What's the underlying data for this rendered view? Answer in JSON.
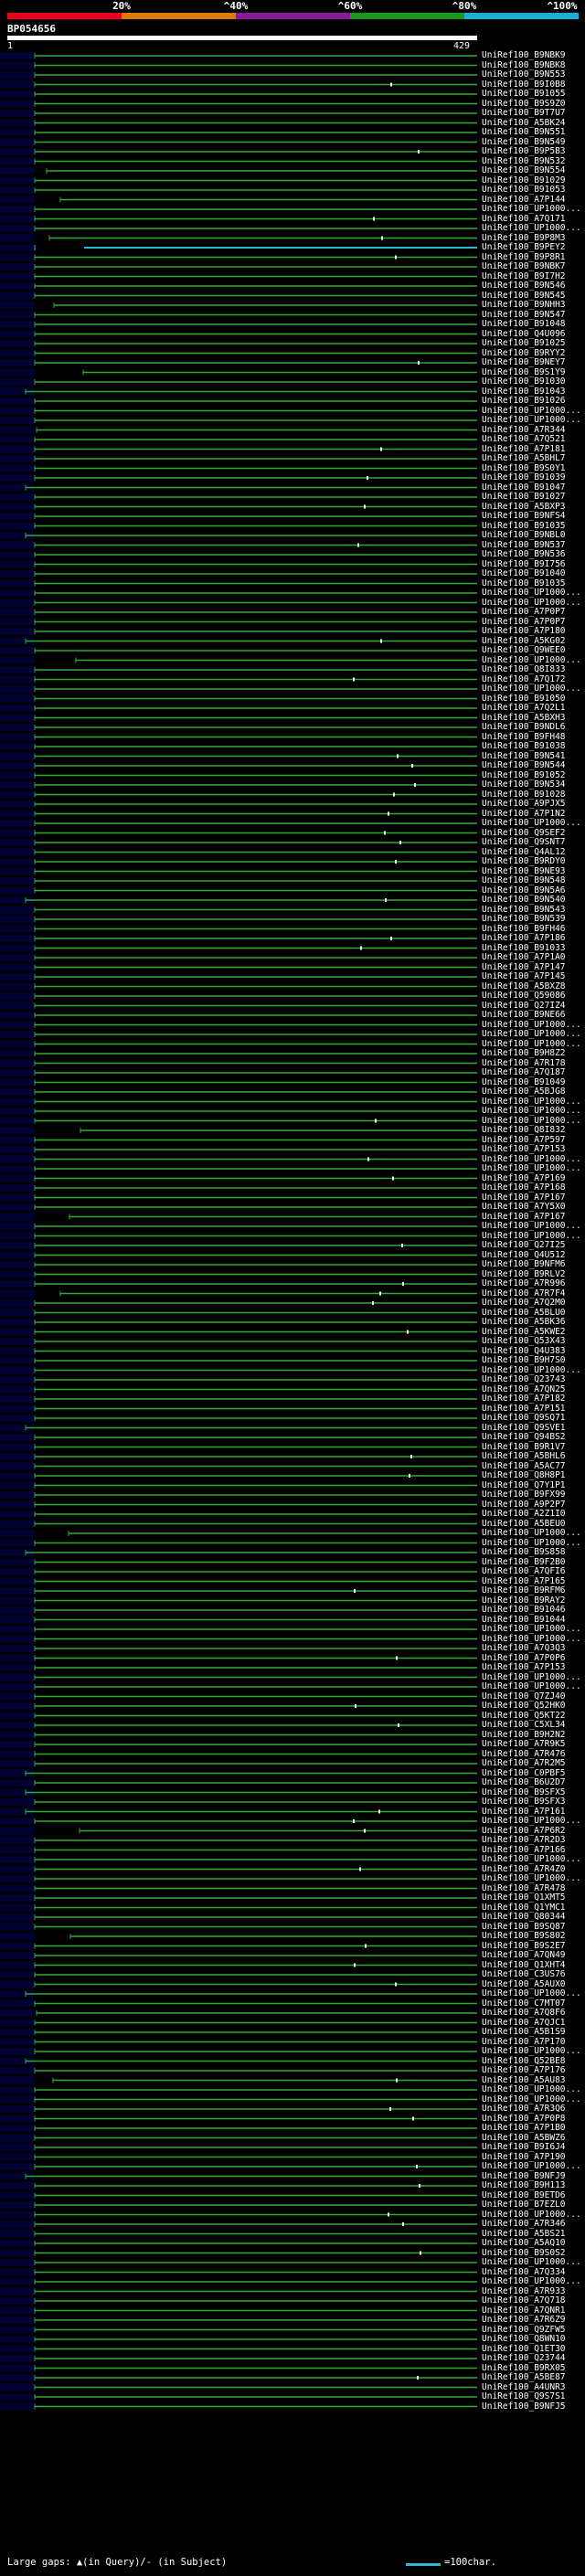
{
  "legend": {
    "marks": [
      "20%",
      "^40%",
      "^60%",
      "^80%",
      "^100%"
    ],
    "colors": [
      "#e8001c",
      "#e07a00",
      "#8a1a9a",
      "#1a9a1a",
      "#1ab0d6"
    ]
  },
  "query": {
    "name": "BP054656",
    "start": "1",
    "end": "429"
  },
  "hits": [
    "UniRef100_B9NBK9",
    "UniRef100_B9NBK8",
    "UniRef100_B9N553",
    "UniRef100_B9I0B8",
    "UniRef100_B91055",
    "UniRef100_B9S9Z0",
    "UniRef100_B9T7U7",
    "UniRef100_A5BK24",
    "UniRef100_B9N551",
    "UniRef100_B9N549",
    "UniRef100_B9P5B3",
    "UniRef100_B9N532",
    "UniRef100_B9N554",
    "UniRef100_B91029",
    "UniRef100_B91053",
    "UniRef100_A7P144",
    "UniRef100_UP1000...",
    "UniRef100_A7Q171",
    "UniRef100_UP1000...",
    "UniRef100_B9P8M3",
    "UniRef100_B9PEY2",
    "UniRef100_B9P8R1",
    "UniRef100_B9NBK7",
    "UniRef100_B9I7H2",
    "UniRef100_B9N546",
    "UniRef100_B9N545",
    "UniRef100_B9NHH3",
    "UniRef100_B9N547",
    "UniRef100_B91048",
    "UniRef100_Q4U096",
    "UniRef100_B91025",
    "UniRef100_B9RYY2",
    "UniRef100_B9NEY7",
    "UniRef100_B9S1Y9",
    "UniRef100_B91030",
    "UniRef100_B91043",
    "UniRef100_B91026",
    "UniRef100_UP1000...",
    "UniRef100_UP1000...",
    "UniRef100_A7R344",
    "UniRef100_A7Q521",
    "UniRef100_A7P181",
    "UniRef100_A5BHL7",
    "UniRef100_B9S0Y1",
    "UniRef100_B91039",
    "UniRef100_B91047",
    "UniRef100_B91027",
    "UniRef100_A5BXP3",
    "UniRef100_B9NFS4",
    "UniRef100_B91035",
    "UniRef100_B9NBL0",
    "UniRef100_B9N537",
    "UniRef100_B9N536",
    "UniRef100_B9I756",
    "UniRef100_B91040",
    "UniRef100_B91035",
    "UniRef100_UP1000...",
    "UniRef100_UP1000...",
    "UniRef100_A7P0P7",
    "UniRef100_A7P0P7",
    "UniRef100_A7P180",
    "UniRef100_A5KG02",
    "UniRef100_Q9WEE0",
    "UniRef100_UP1000...",
    "UniRef100_Q8I833",
    "UniRef100_A7Q172",
    "UniRef100_UP1000...",
    "UniRef100_B91050",
    "UniRef100_A7Q2L1",
    "UniRef100_A5BXH3",
    "UniRef100_B9NDL6",
    "UniRef100_B9FH48",
    "UniRef100_B91038",
    "UniRef100_B9N541",
    "UniRef100_B9N544",
    "UniRef100_B91052",
    "UniRef100_B9N534",
    "UniRef100_B91028",
    "UniRef100_A9PJX5",
    "UniRef100_A7P1N2",
    "UniRef100_UP1000...",
    "UniRef100_Q9SEF2",
    "UniRef100_Q9SNT7",
    "UniRef100_Q4AL12",
    "UniRef100_B9RDY0",
    "UniRef100_B9NE93",
    "UniRef100_B9N548",
    "UniRef100_B9N5A6",
    "UniRef100_B9N540",
    "UniRef100_B9N543",
    "UniRef100_B9N539",
    "UniRef100_B9FH46",
    "UniRef100_A7P186",
    "UniRef100_B91033",
    "UniRef100_A7P1A0",
    "UniRef100_A7P147",
    "UniRef100_A7P145",
    "UniRef100_A5BXZ8",
    "UniRef100_Q59086",
    "UniRef100_Q27IZ4",
    "UniRef100_B9NE66",
    "UniRef100_UP1000...",
    "UniRef100_UP1000...",
    "UniRef100_UP1000...",
    "UniRef100_B9H8Z2",
    "UniRef100_A7R178",
    "UniRef100_A7Q187",
    "UniRef100_B91049",
    "UniRef100_A5BJG8",
    "UniRef100_UP1000...",
    "UniRef100_UP1000...",
    "UniRef100_UP1000...",
    "UniRef100_Q8I832",
    "UniRef100_A7P597",
    "UniRef100_A7P153",
    "UniRef100_UP1000...",
    "UniRef100_UP1000...",
    "UniRef100_A7P169",
    "UniRef100_A7P168",
    "UniRef100_A7P167",
    "UniRef100_A7Y5X0",
    "UniRef100_A7P167",
    "UniRef100_UP1000...",
    "UniRef100_UP1000...",
    "UniRef100_Q27I25",
    "UniRef100_Q4U512",
    "UniRef100_B9NFM6",
    "UniRef100_B9RLV2",
    "UniRef100_A7R996",
    "UniRef100_A7R7F4",
    "UniRef100_A7Q2M0",
    "UniRef100_A5BLU0",
    "UniRef100_A5BK36",
    "UniRef100_A5KWE2",
    "UniRef100_Q53X43",
    "UniRef100_Q4U383",
    "UniRef100_B9H7S0",
    "UniRef100_UP1000...",
    "UniRef100_Q23743",
    "UniRef100_A7QN25",
    "UniRef100_A7P182",
    "UniRef100_A7P151",
    "UniRef100_Q9SQ71",
    "UniRef100_Q9SVE1",
    "UniRef100_Q94BS2",
    "UniRef100_B9R1V7",
    "UniRef100_A5BHL6",
    "UniRef100_A5AC77",
    "UniRef100_Q8H8P1",
    "UniRef100_Q7Y1P1",
    "UniRef100_B9FX99",
    "UniRef100_A9P2P7",
    "UniRef100_A2Z1I0",
    "UniRef100_A5BEU0",
    "UniRef100_UP1000...",
    "UniRef100_UP1000...",
    "UniRef100_B9S858",
    "UniRef100_B9F2B0",
    "UniRef100_A7QFI6",
    "UniRef100_A7P165",
    "UniRef100_B9RFM6",
    "UniRef100_B9RAY2",
    "UniRef100_B91046",
    "UniRef100_B91044",
    "UniRef100_UP1000...",
    "UniRef100_UP1000...",
    "UniRef100_A7Q3Q3",
    "UniRef100_A7P0P6",
    "UniRef100_A7P153",
    "UniRef100_UP1000...",
    "UniRef100_UP1000...",
    "UniRef100_Q7ZJ40",
    "UniRef100_Q52HK0",
    "UniRef100_Q5KT22",
    "UniRef100_C5XL34",
    "UniRef100_B9H2N2",
    "UniRef100_A7R9K5",
    "UniRef100_A7R476",
    "UniRef100_A7R2M5",
    "UniRef100_C0PBF5",
    "UniRef100_B6U2D7",
    "UniRef100_B9SFX5",
    "UniRef100_B9SFX3",
    "UniRef100_A7P161",
    "UniRef100_UP1000...",
    "UniRef100_A7P6R2",
    "UniRef100_A7R2D3",
    "UniRef100_A7P166",
    "UniRef100_UP1000...",
    "UniRef100_A7R4Z0",
    "UniRef100_UP1000...",
    "UniRef100_A7R478",
    "UniRef100_Q1XMT5",
    "UniRef100_Q1YMC1",
    "UniRef100_Q80344",
    "UniRef100_B9SQ87",
    "UniRef100_B9S802",
    "UniRef100_B9S2E7",
    "UniRef100_A7QN49",
    "UniRef100_Q1XHT4",
    "UniRef100_C3US76",
    "UniRef100_A5AUX0",
    "UniRef100_UP1000...",
    "UniRef100_C7MT07",
    "UniRef100_A7Q8F6",
    "UniRef100_A7QJC1",
    "UniRef100_A5B1S9",
    "UniRef100_A7P170",
    "UniRef100_UP1000...",
    "UniRef100_Q52BE8",
    "UniRef100_A7P176",
    "UniRef100_A5AU83",
    "UniRef100_UP1000...",
    "UniRef100_UP1000...",
    "UniRef100_A7R3Q6",
    "UniRef100_A7P0P8",
    "UniRef100_A7P1B0",
    "UniRef100_A5BWZ6",
    "UniRef100_B9I6J4",
    "UniRef100_A7P190",
    "UniRef100_UP1000...",
    "UniRef100_B9NFJ9",
    "UniRef100_B9H113",
    "UniRef100_B9ETD6",
    "UniRef100_B7EZL0",
    "UniRef100_UP1000...",
    "UniRef100_A7R346",
    "UniRef100_A5BS21",
    "UniRef100_A5AQ10",
    "UniRef100_B9S0S2",
    "UniRef100_UP1000...",
    "UniRef100_A7Q334",
    "UniRef100_UP1000...",
    "UniRef100_A7R933",
    "UniRef100_A7Q718",
    "UniRef100_A7QNR1",
    "UniRef100_A7R6Z9",
    "UniRef100_Q9ZFW5",
    "UniRef100_Q8WN10",
    "UniRef100_Q1ET30",
    "UniRef100_Q23744",
    "UniRef100_B9RX05",
    "UniRef100_A5BE87",
    "UniRef100_A4UNR3",
    "UniRef100_Q9S7S1",
    "UniRef100_B9NFJ5"
  ],
  "footer": {
    "large_gaps": "Large gaps: ▲(in Query)/‐ (in Subject)",
    "scale": "=100char."
  }
}
